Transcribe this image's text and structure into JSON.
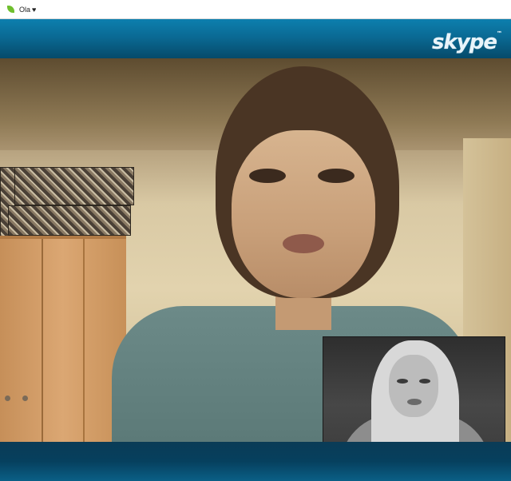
{
  "window": {
    "contact_name": "Ola",
    "heart_glyph": "♥",
    "status_icon": "online-status-icon"
  },
  "brand": {
    "logo_text": "skype",
    "trademark": "™"
  },
  "colors": {
    "topbar": "#0a6a94",
    "bottombar": "#06405e",
    "status_online": "#6fbf2e"
  }
}
